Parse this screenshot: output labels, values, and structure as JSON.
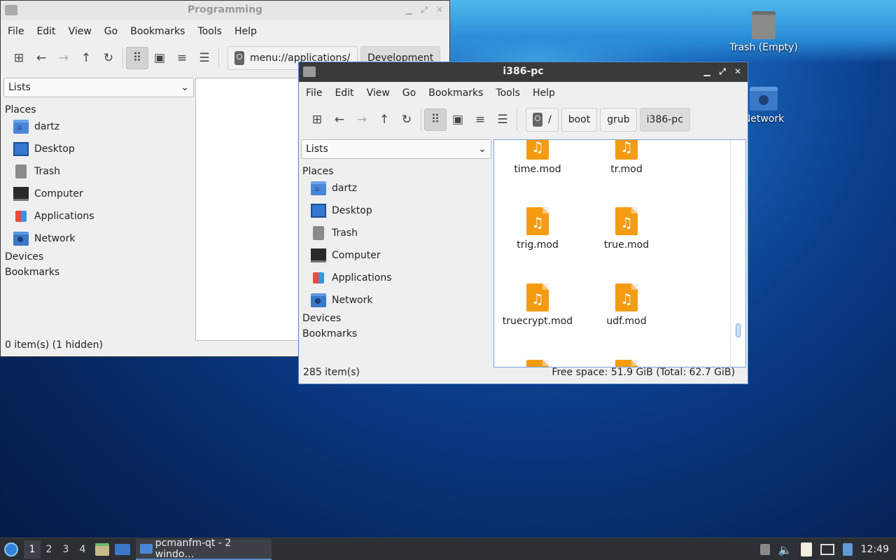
{
  "desktop": {
    "icons": [
      {
        "label": "Trash (Empty)"
      },
      {
        "label": "Network"
      }
    ]
  },
  "window_back": {
    "title": "Programming",
    "menu": [
      "File",
      "Edit",
      "View",
      "Go",
      "Bookmarks",
      "Tools",
      "Help"
    ],
    "address": "menu://applications/",
    "crumb_extra": "Development",
    "combo": "Lists",
    "places_heading": "Places",
    "places": [
      "dartz",
      "Desktop",
      "Trash",
      "Computer",
      "Applications",
      "Network"
    ],
    "devices_heading": "Devices",
    "bookmarks_heading": "Bookmarks",
    "status": "0 item(s) (1 hidden)"
  },
  "window_front": {
    "title": "i386-pc",
    "menu": [
      "File",
      "Edit",
      "View",
      "Go",
      "Bookmarks",
      "Tools",
      "Help"
    ],
    "crumbs": [
      "/",
      "boot",
      "grub",
      "i386-pc"
    ],
    "combo": "Lists",
    "places_heading": "Places",
    "places": [
      "dartz",
      "Desktop",
      "Trash",
      "Computer",
      "Applications",
      "Network"
    ],
    "devices_heading": "Devices",
    "bookmarks_heading": "Bookmarks",
    "files": [
      "time.mod",
      "tr.mod",
      "trig.mod",
      "true.mod",
      "truecrypt.mod",
      "udf.mod"
    ],
    "status_left": "285 item(s)",
    "status_right": "Free space: 51.9 GiB (Total: 62.7 GiB)"
  },
  "taskbar": {
    "workspaces": [
      "1",
      "2",
      "3",
      "4"
    ],
    "task_label": "pcmanfm-qt - 2 windo…",
    "clock": "12:49"
  }
}
